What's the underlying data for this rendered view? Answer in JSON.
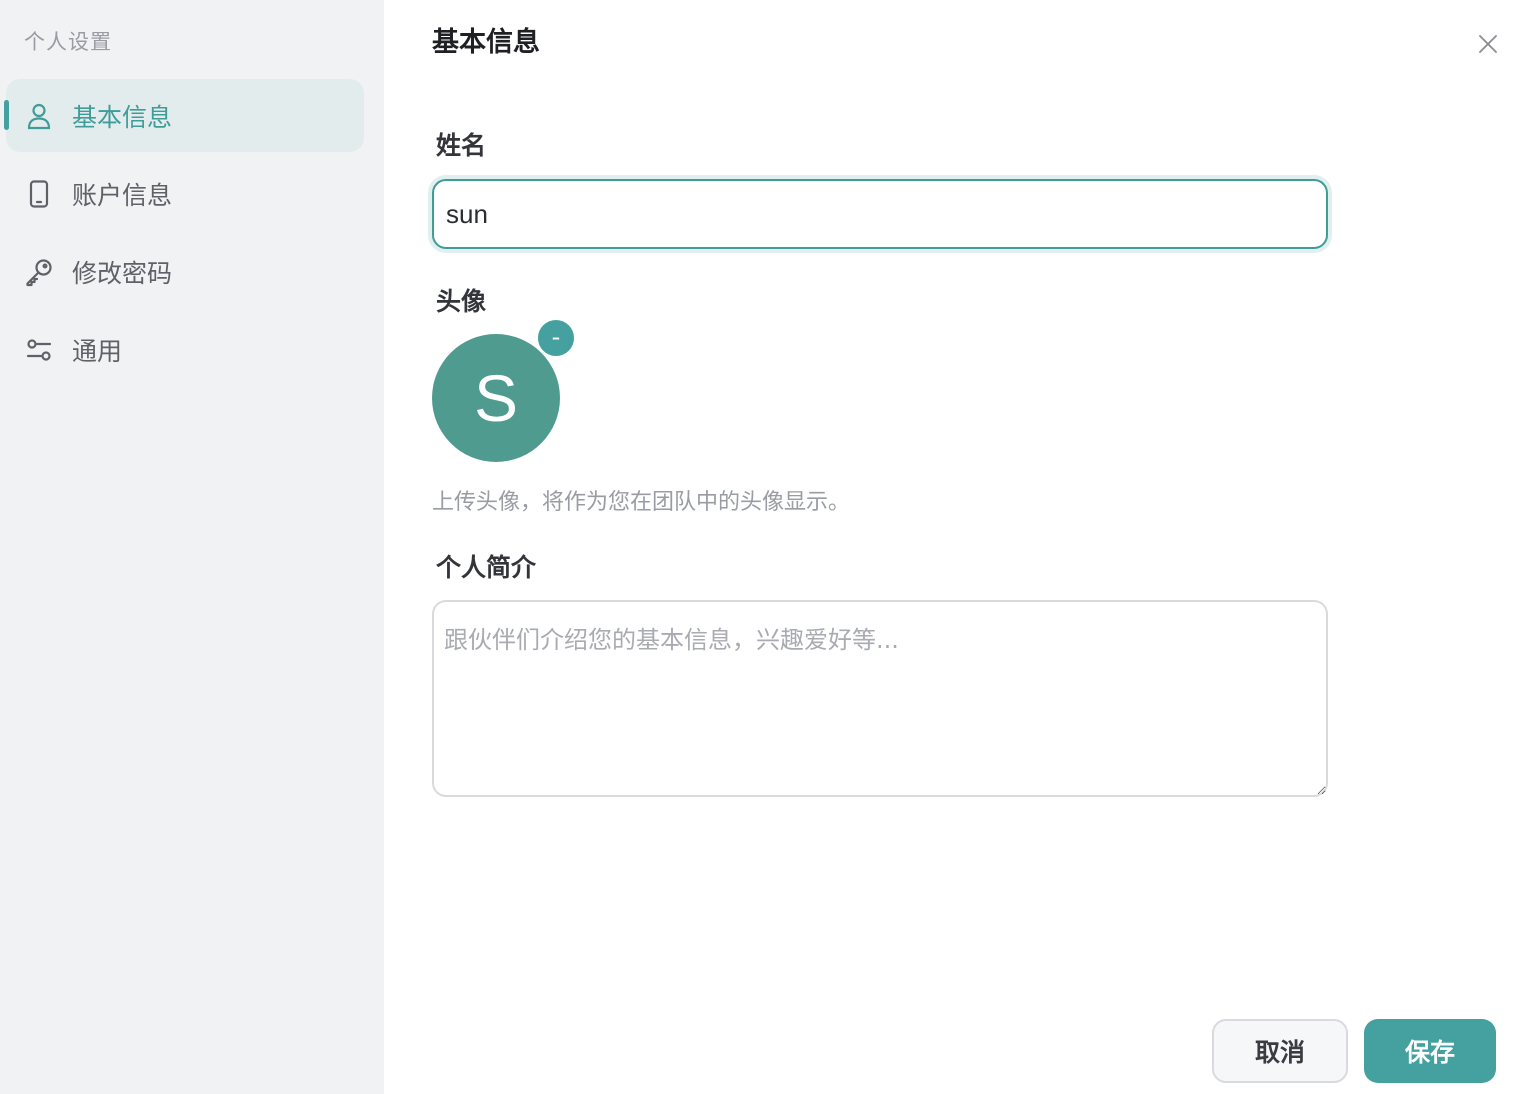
{
  "sidebar": {
    "title": "个人设置",
    "items": [
      {
        "label": "基本信息",
        "icon": "user-icon",
        "active": true
      },
      {
        "label": "账户信息",
        "icon": "phone-icon",
        "active": false
      },
      {
        "label": "修改密码",
        "icon": "key-icon",
        "active": false
      },
      {
        "label": "通用",
        "icon": "sliders-icon",
        "active": false
      }
    ]
  },
  "main": {
    "title": "基本信息",
    "close_icon": "close-icon",
    "name": {
      "label": "姓名",
      "value": "sun"
    },
    "avatar": {
      "label": "头像",
      "initial": "S",
      "remove_label": "-",
      "hint": "上传头像，将作为您在团队中的头像显示。"
    },
    "bio": {
      "label": "个人简介",
      "value": "",
      "placeholder": "跟伙伴们介绍您的基本信息，兴趣爱好等..."
    },
    "actions": {
      "cancel_label": "取消",
      "save_label": "保存"
    }
  },
  "colors": {
    "accent": "#44a1a0",
    "avatar_bg": "#4f9b8f",
    "sidebar_bg": "#f1f2f4",
    "active_item_bg": "#e3ecec"
  }
}
